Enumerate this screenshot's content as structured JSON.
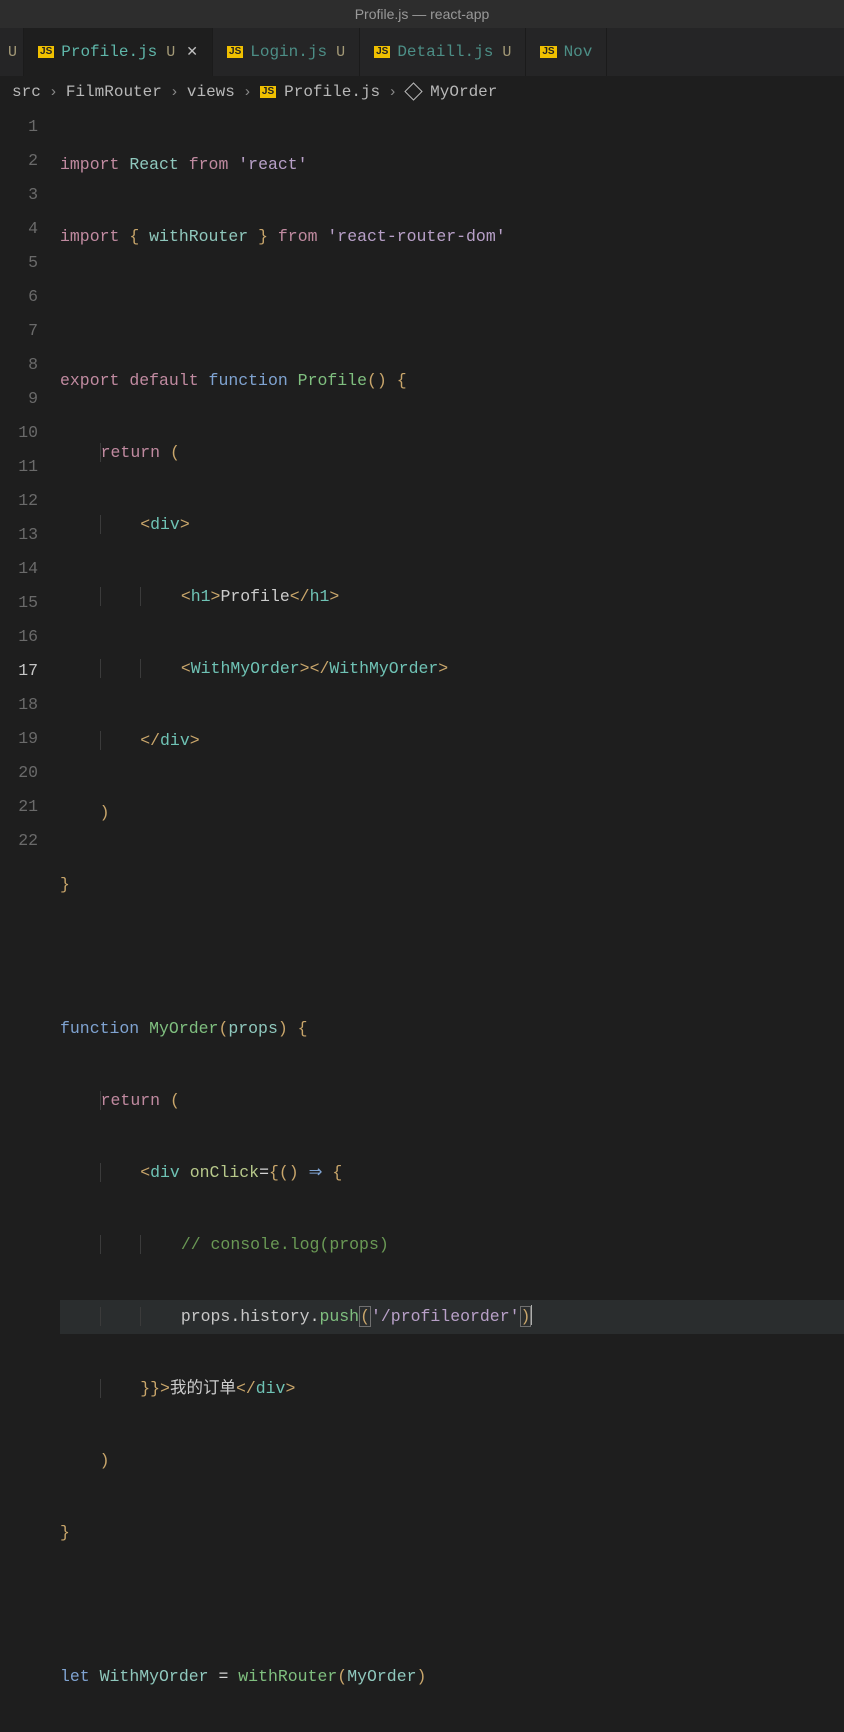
{
  "window": {
    "title": "Profile.js — react-app"
  },
  "tabs": {
    "stub_prev": {
      "status": "U"
    },
    "active": {
      "file": "Profile.js",
      "status": "U"
    },
    "t2": {
      "file": "Login.js",
      "status": "U"
    },
    "t3": {
      "file": "Detaill.js",
      "status": "U"
    },
    "t4": {
      "file": "Nov"
    }
  },
  "breadcrumb": {
    "p0": "src",
    "p1": "FilmRouter",
    "p2": "views",
    "p3": "Profile.js",
    "p4": "MyOrder"
  },
  "gutter": {
    "l1": "1",
    "l2": "2",
    "l3": "3",
    "l4": "4",
    "l5": "5",
    "l6": "6",
    "l7": "7",
    "l8": "8",
    "l9": "9",
    "l10": "10",
    "l11": "11",
    "l12": "12",
    "l13": "13",
    "l14": "14",
    "l15": "15",
    "l16": "16",
    "l17": "17",
    "l18": "18",
    "l19": "19",
    "l20": "20",
    "l21": "21",
    "l22": "22"
  },
  "code": {
    "l1": {
      "import": "import",
      "React": "React",
      "from": "from",
      "str": "'react'"
    },
    "l2": {
      "import": "import",
      "lb": "{",
      "withRouter": "withRouter",
      "rb": "}",
      "from": "from",
      "str": "'react-router-dom'"
    },
    "l4": {
      "export": "export",
      "default": "default",
      "function": "function",
      "name": "Profile",
      "parens": "()",
      "ob": "{"
    },
    "l5": {
      "return": "return",
      "op": "("
    },
    "l6": {
      "lt": "<",
      "tag": "div",
      "gt": ">"
    },
    "l7": {
      "lt": "<",
      "tag": "h1",
      "gt": ">",
      "text": "Profile",
      "clt": "</",
      "ctag": "h1",
      "cgt": ">"
    },
    "l8": {
      "lt": "<",
      "tag": "WithMyOrder",
      "gt": ">",
      "clt": "</",
      "ctag": "WithMyOrder",
      "cgt": ">"
    },
    "l9": {
      "clt": "</",
      "tag": "div",
      "gt": ">"
    },
    "l10": {
      "cp": ")"
    },
    "l11": {
      "cb": "}"
    },
    "l13": {
      "function": "function",
      "name": "MyOrder",
      "op": "(",
      "param": "props",
      "cp": ")",
      "ob": "{"
    },
    "l14": {
      "return": "return",
      "op": "("
    },
    "l15": {
      "lt": "<",
      "tag": "div",
      "sp": " ",
      "attr": "onClick",
      "eq": "=",
      "ob": "{",
      "po": "(",
      "pc": ")",
      "arrow": "⇒",
      "ob2": "{"
    },
    "l16": {
      "comment": "// console.log(props)"
    },
    "l17": {
      "obj": "props",
      "d1": ".",
      "prop1": "history",
      "d2": ".",
      "method": "push",
      "op": "(",
      "str": "'/profileorder'",
      "cp": ")"
    },
    "l18": {
      "cb": "}",
      "cb2": "}",
      "gt": ">",
      "text": "我的订单",
      "clt": "</",
      "tag": "div",
      "cgt": ">"
    },
    "l19": {
      "cp": ")"
    },
    "l20": {
      "cb": "}"
    },
    "l22": {
      "let": "let",
      "name": "WithMyOrder",
      "eq": "=",
      "fn": "withRouter",
      "op": "(",
      "arg": "MyOrder",
      "cp": ")"
    }
  }
}
